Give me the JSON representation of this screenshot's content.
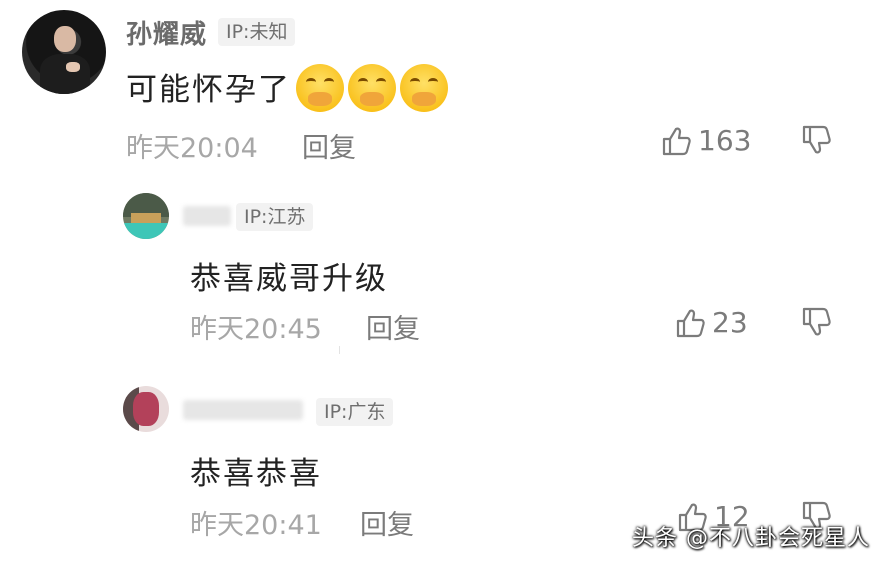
{
  "comment": {
    "user": "孙耀威",
    "ip": "IP:未知",
    "text": "可能怀孕了",
    "emojis": [
      "hand-over-mouth-emoji",
      "hand-over-mouth-emoji",
      "hand-over-mouth-emoji"
    ],
    "time": "昨天20:04",
    "reply_label": "回复",
    "likes": "163"
  },
  "replies": [
    {
      "ip": "IP:江苏",
      "text": "恭喜威哥升级",
      "time": "昨天20:45",
      "reply_label": "回复",
      "likes": "23"
    },
    {
      "ip": "IP:广东",
      "text": "恭喜恭喜",
      "time": "昨天20:41",
      "reply_label": "回复",
      "likes": "12"
    }
  ],
  "watermark": "头条 @不八卦会死星人",
  "icons": {
    "like": "thumbs-up-icon",
    "dislike": "thumbs-down-icon"
  },
  "colors": {
    "username": "#6b6b6b",
    "secondary_text": "#a7a7a7",
    "ip_tag_bg": "#f2f2f2"
  }
}
